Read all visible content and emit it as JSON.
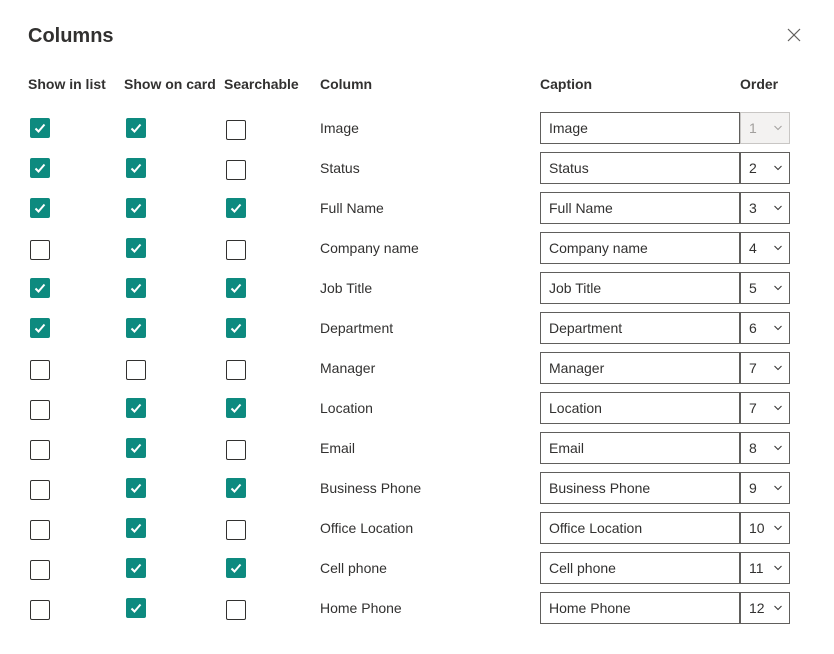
{
  "title": "Columns",
  "headers": {
    "show_in_list": "Show in list",
    "show_on_card": "Show on card",
    "searchable": "Searchable",
    "column": "Column",
    "caption": "Caption",
    "order": "Order"
  },
  "rows": [
    {
      "show_in_list": true,
      "show_on_card": true,
      "searchable": false,
      "column": "Image",
      "caption": "Image",
      "order": "1",
      "order_disabled": true
    },
    {
      "show_in_list": true,
      "show_on_card": true,
      "searchable": false,
      "column": "Status",
      "caption": "Status",
      "order": "2",
      "order_disabled": false
    },
    {
      "show_in_list": true,
      "show_on_card": true,
      "searchable": true,
      "column": "Full Name",
      "caption": "Full Name",
      "order": "3",
      "order_disabled": false
    },
    {
      "show_in_list": false,
      "show_on_card": true,
      "searchable": false,
      "column": "Company name",
      "caption": "Company name",
      "order": "4",
      "order_disabled": false
    },
    {
      "show_in_list": true,
      "show_on_card": true,
      "searchable": true,
      "column": "Job Title",
      "caption": "Job Title",
      "order": "5",
      "order_disabled": false
    },
    {
      "show_in_list": true,
      "show_on_card": true,
      "searchable": true,
      "column": "Department",
      "caption": "Department",
      "order": "6",
      "order_disabled": false
    },
    {
      "show_in_list": false,
      "show_on_card": false,
      "searchable": false,
      "column": "Manager",
      "caption": "Manager",
      "order": "7",
      "order_disabled": false
    },
    {
      "show_in_list": false,
      "show_on_card": true,
      "searchable": true,
      "column": "Location",
      "caption": "Location",
      "order": "7",
      "order_disabled": false
    },
    {
      "show_in_list": false,
      "show_on_card": true,
      "searchable": false,
      "column": "Email",
      "caption": "Email",
      "order": "8",
      "order_disabled": false
    },
    {
      "show_in_list": false,
      "show_on_card": true,
      "searchable": true,
      "column": "Business Phone",
      "caption": "Business Phone",
      "order": "9",
      "order_disabled": false
    },
    {
      "show_in_list": false,
      "show_on_card": true,
      "searchable": false,
      "column": "Office Location",
      "caption": "Office Location",
      "order": "10",
      "order_disabled": false
    },
    {
      "show_in_list": false,
      "show_on_card": true,
      "searchable": true,
      "column": "Cell phone",
      "caption": "Cell phone",
      "order": "11",
      "order_disabled": false
    },
    {
      "show_in_list": false,
      "show_on_card": true,
      "searchable": false,
      "column": "Home Phone",
      "caption": "Home Phone",
      "order": "12",
      "order_disabled": false
    }
  ]
}
